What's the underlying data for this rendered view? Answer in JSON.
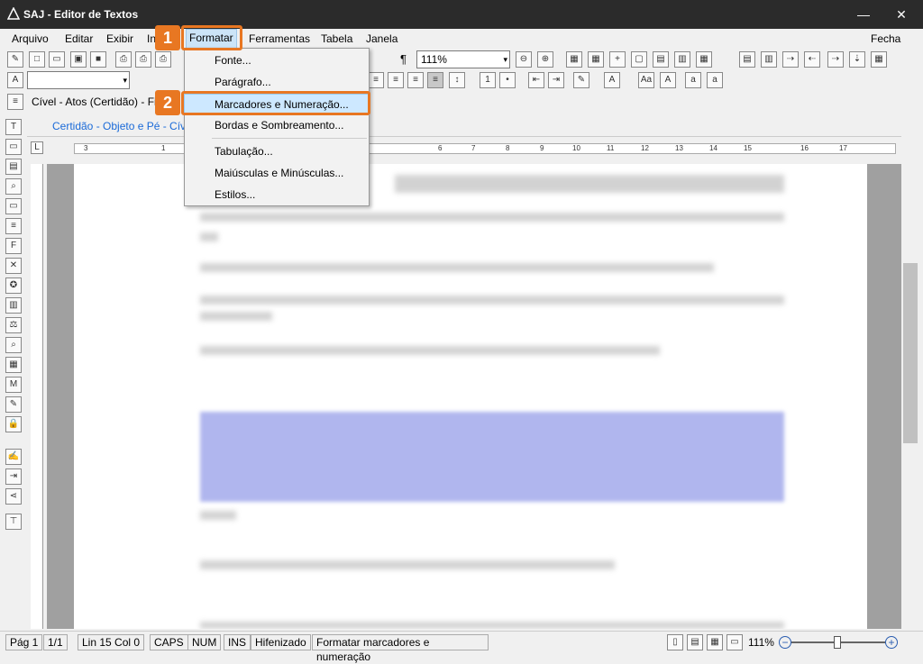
{
  "window": {
    "title": "SAJ - Editor de Textos"
  },
  "menu": {
    "items": [
      "Arquivo",
      "Editar",
      "Exibir",
      "In",
      "Formatar",
      "Ferramentas",
      "Tabela",
      "Janela"
    ],
    "close": "Fechar"
  },
  "toolbar": {
    "zoom": "111%",
    "paragraph_mark": "¶"
  },
  "doc_tabs": {
    "model": "Cível - Atos (Certidão) - Fi",
    "section": "Certidão - Objeto e Pé - Cíve"
  },
  "format_menu": {
    "items": [
      "Fonte...",
      "Parágrafo...",
      "Marcadores e Numeração...",
      "Bordas e Sombreamento...",
      "Tabulação...",
      "Maiúsculas e Minúsculas...",
      "Estilos..."
    ],
    "highlighted_index": 2
  },
  "steps": {
    "one": "1",
    "two": "2"
  },
  "accent_color": "#e87722",
  "ruler": {
    "labels": [
      "3",
      "1",
      "6",
      "7",
      "8",
      "9",
      "10",
      "11",
      "12",
      "13",
      "14",
      "15",
      "16",
      "17"
    ]
  },
  "status": {
    "page": "Pág 1",
    "pages": "1/1",
    "position": "Lin 15  Col 0",
    "caps": "CAPS",
    "num": "NUM",
    "ins": "INS",
    "hyphen": "Hifenizado",
    "message": "Formatar marcadores e numeração",
    "zoom": "111%"
  }
}
